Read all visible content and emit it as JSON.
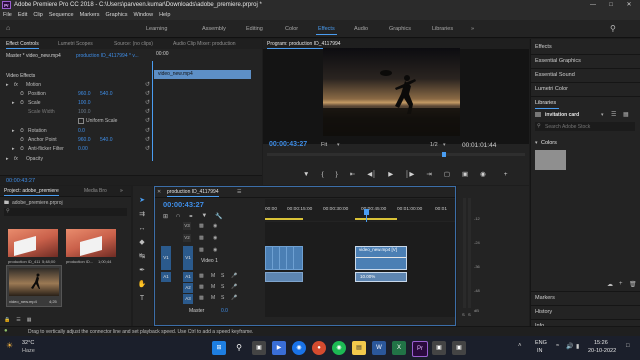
{
  "window": {
    "title": "Adobe Premiere Pro CC 2018 - C:\\Users\\parveen.kumar\\Downloads\\adobe_premiere.prproj *",
    "logo": "Pr"
  },
  "menu": [
    "File",
    "Edit",
    "Clip",
    "Sequence",
    "Markers",
    "Graphics",
    "Window",
    "Help"
  ],
  "workspaces": {
    "items": [
      "Learning",
      "Assembly",
      "Editing",
      "Color",
      "Effects",
      "Audio",
      "Graphics",
      "Libraries"
    ],
    "active": "Effects",
    "more": "»"
  },
  "effect_controls": {
    "tabs": [
      "Effect Controls",
      "Lumetri Scopes",
      "Source: (no clips)",
      "Audio Clip Mixer: production"
    ],
    "master_label": "Master * video_new.mp4",
    "sequence_label": "production ID_4117994 * v...",
    "clip_label": "video_new.mp4",
    "ruler_time": "00:00",
    "section": "Video Effects",
    "fx_label": "fx",
    "motion": "Motion",
    "position": {
      "label": "Position",
      "x": "960.0",
      "y": "540.0"
    },
    "scale": {
      "label": "Scale",
      "value": "100.0"
    },
    "scale_width": {
      "label": "Scale Width",
      "value": "100.0"
    },
    "uniform_scale": "Uniform Scale",
    "rotation": {
      "label": "Rotation",
      "value": "0.0"
    },
    "anchor": {
      "label": "Anchor Point",
      "x": "960.0",
      "y": "540.0"
    },
    "antiflicker": {
      "label": "Anti-flicker Filter",
      "value": "0.00"
    },
    "opacity": "Opacity",
    "timecode": "00:00:43:27"
  },
  "program": {
    "title": "Program: production ID_4117994",
    "timecode": "00:00:43:27",
    "fit": "Fit",
    "quality": "1/2",
    "duration": "00:01:01:44"
  },
  "project": {
    "tabs": [
      "Project: adobe_premiere",
      "Media Bro"
    ],
    "file": "adobe_premiere.prproj",
    "items": [
      {
        "name": "production ID_4117...",
        "duration": "5;48;00"
      },
      {
        "name": "production ID...",
        "duration": "1;00;44"
      },
      {
        "name": "video_new.mp4",
        "duration": "4;25"
      }
    ]
  },
  "timeline": {
    "title": "production ID_4117994",
    "timecode": "00:00:43:27",
    "ruler": [
      "00:00",
      "00:00:15:00",
      "00:00:30:00",
      "00:00:45:00",
      "00:01:00:00",
      "00:01"
    ],
    "tracks_video": [
      "V3",
      "V2",
      "V1"
    ],
    "tracks_audio": [
      "A1",
      "A2",
      "A3"
    ],
    "track_label_video": "Video 1",
    "clip_label": "video_new.mp4 [V]",
    "speed_label": "10.00%",
    "master": {
      "label": "Master",
      "value": "0.0"
    },
    "meter_labels": [
      "-12",
      "-24",
      "-36",
      "-48",
      "dB"
    ],
    "meter_channels": [
      "S",
      "S"
    ]
  },
  "right_panel": {
    "items": [
      "Effects",
      "Essential Graphics",
      "Essential Sound",
      "Lumetri Color"
    ],
    "libraries": "Libraries",
    "library_name": "invitation card",
    "search_placeholder": "Search Adobe Stock",
    "colors": "Colors",
    "bottom_items": [
      "Markers",
      "History",
      "Info"
    ]
  },
  "status": "Drag to vertically adjust the connector line and set playback speed. Use Ctrl to add a speed keyframe.",
  "taskbar": {
    "weather_temp": "32°C",
    "weather_text": "Haze",
    "lang": "ENG",
    "region": "IN",
    "time": "15:26",
    "date": "20-10-2022"
  },
  "colors": {
    "accent": "#4a9df1",
    "clip_video": "#4b7fb4",
    "clip_audio": "#5d85b1",
    "track_active": "#2b5a8c",
    "playhead": "#4a9df1"
  }
}
